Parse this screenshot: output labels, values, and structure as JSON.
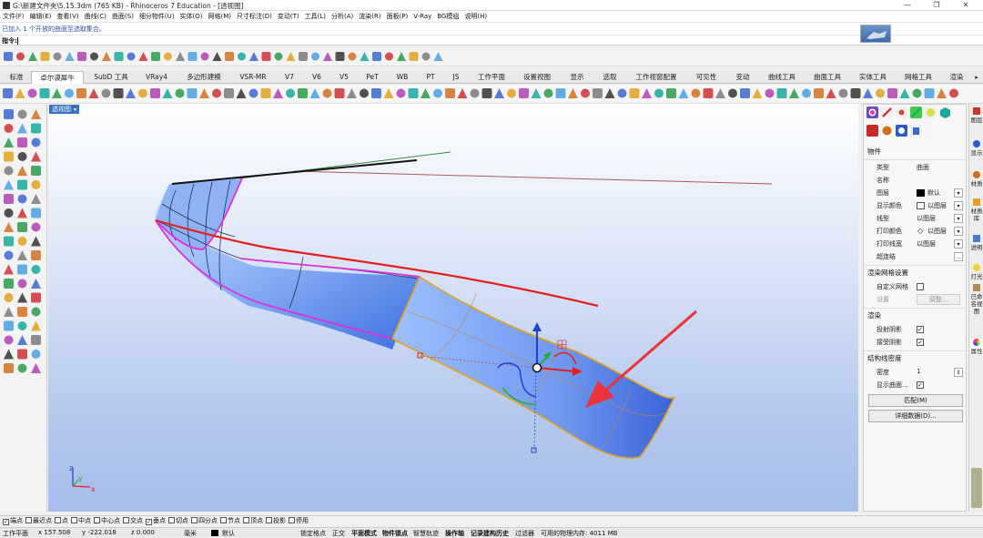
{
  "window": {
    "title": "G:\\新建文件夹\\5.15.3dm (765 KB) - Rhinoceros 7 Education - [透视图]",
    "buttons": [
      "—",
      "❐",
      "✕"
    ]
  },
  "menubar": [
    "文件(F)",
    "编辑(E)",
    "查看(V)",
    "曲线(C)",
    "曲面(S)",
    "细分物件(U)",
    "实体(O)",
    "网格(M)",
    "尺寸标注(D)",
    "变动(T)",
    "工具(L)",
    "分析(A)",
    "渲染(R)",
    "面板(P)",
    "V-Ray",
    "BG模组",
    "说明(H)"
  ],
  "command": {
    "history": "已加入 1 个开放的曲面至选取集合。",
    "prompt_label": "指令:"
  },
  "tabs": [
    "标准",
    "卓尔谟犀牛",
    "SubD 工具",
    "VRay4",
    "多边形建模",
    "VSR-MR",
    "V7",
    "V6",
    "V5",
    "PeT",
    "WB",
    "PT",
    "JS",
    "工作平面",
    "设置视图",
    "显示",
    "选取",
    "工作视窗配置",
    "可见性",
    "变动",
    "曲线工具",
    "曲面工具",
    "实体工具",
    "网格工具",
    "渲染"
  ],
  "active_tab": "卓尔谟犀牛",
  "viewport": {
    "title": "透视图",
    "dropdown": "▾",
    "axis": {
      "x": "x",
      "y": "y",
      "z": "z"
    },
    "colors": {
      "surface_top": "#cfe0ff",
      "surface_mid": "#8cb2f5",
      "surface_edge": "#3f6fe0",
      "edge_magenta": "#dd30dd",
      "edge_orange": "#e0a020",
      "curve_red": "#e81c1c",
      "arrow_red": "#e8343a",
      "gumball_blue": "#1f3fd8",
      "gumball_green": "#22aa33"
    }
  },
  "panel": {
    "section_object": "物件",
    "rows": [
      {
        "label": "类型",
        "value": "曲面"
      },
      {
        "label": "名称",
        "value": ""
      },
      {
        "label": "图层",
        "value": "默认"
      },
      {
        "label": "显示颜色",
        "value": "以图层"
      },
      {
        "label": "线型",
        "value": "以图层"
      },
      {
        "label": "打印颜色",
        "value": "以图层"
      },
      {
        "label": "打印线宽",
        "value": "以图层"
      },
      {
        "label": "超连结",
        "value": ""
      }
    ],
    "section_mesh": "渲染网格设置",
    "custom_mesh_label": "自定义网格",
    "settings_label": "设置",
    "adjust_button": "调整...",
    "section_render": "渲染",
    "cast_shadow": "投射阴影",
    "receive_shadow": "接受阴影",
    "section_iso": "结构线密度",
    "density_label": "密度",
    "density_value": "1",
    "show_iso_label": "显示曲面...",
    "match_button": "匹配(M)",
    "details_button": "详细数据(D)..."
  },
  "side_tabs": [
    "图层",
    "显示",
    "材质",
    "材质库",
    "说明",
    "灯光",
    "已命名视图",
    "属性"
  ],
  "osnap": [
    {
      "label": "端点",
      "checked": true
    },
    {
      "label": "最近点",
      "checked": false
    },
    {
      "label": "点",
      "checked": false
    },
    {
      "label": "中点",
      "checked": false
    },
    {
      "label": "中心点",
      "checked": false
    },
    {
      "label": "交点",
      "checked": false
    },
    {
      "label": "垂点",
      "checked": true
    },
    {
      "label": "切点",
      "checked": false
    },
    {
      "label": "四分点",
      "checked": false
    },
    {
      "label": "节点",
      "checked": false
    },
    {
      "label": "顶点",
      "checked": false
    },
    {
      "label": "投影",
      "checked": false
    },
    {
      "label": "停用",
      "checked": false
    }
  ],
  "status": {
    "cplane": "工作平面",
    "x": "x 157.508",
    "y": "y -222.018",
    "z": "z 0.000",
    "units": "毫米",
    "layer": "默认",
    "toggles": [
      "锁定格点",
      "正交",
      "平面模式",
      "物件锁点",
      "智慧轨迹",
      "操作轴",
      "记录建构历史",
      "过滤器"
    ],
    "memory": "可用的物理内存: 4011 MB"
  }
}
